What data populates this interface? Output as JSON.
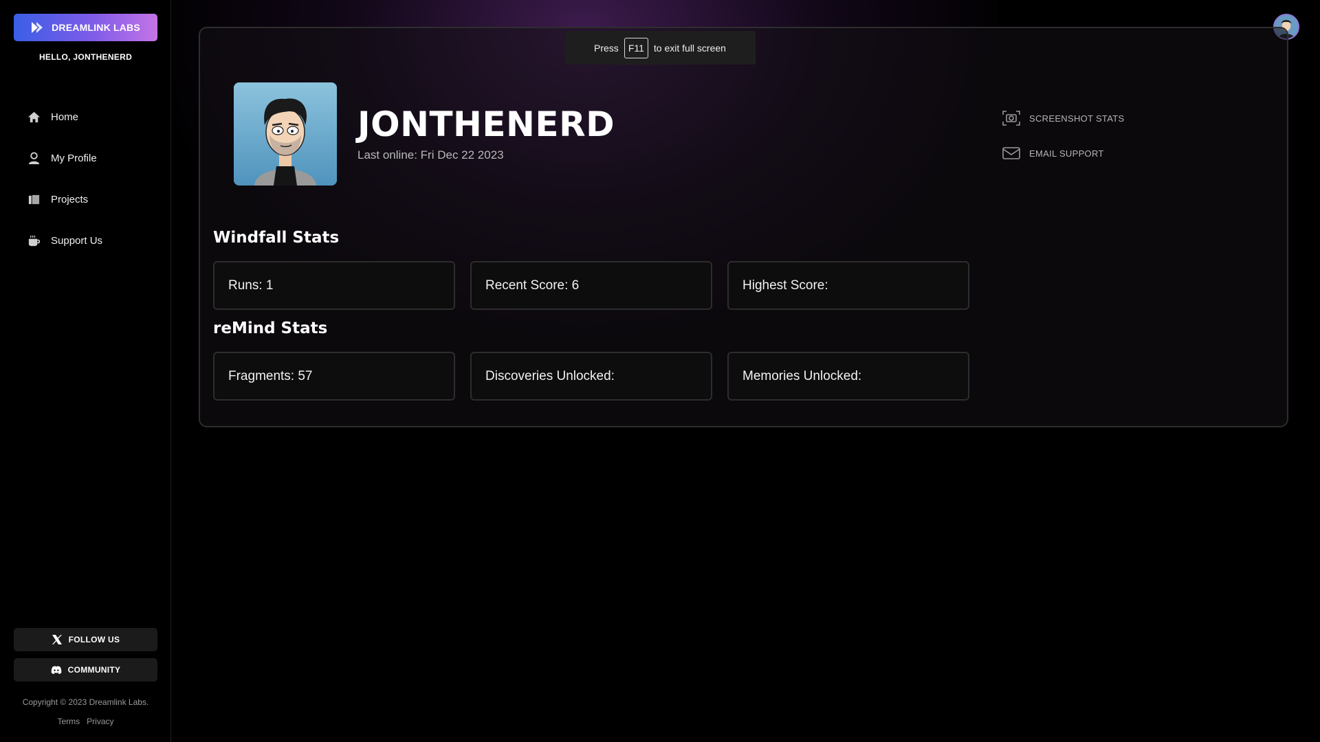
{
  "sidebar": {
    "brand_label": "DREAMLINK LABS",
    "greeting": "HELLO, JONTHENERD",
    "nav": [
      {
        "label": "Home",
        "icon": "home-icon"
      },
      {
        "label": "My Profile",
        "icon": "user-icon"
      },
      {
        "label": "Projects",
        "icon": "projects-icon"
      },
      {
        "label": "Support Us",
        "icon": "coffee-icon"
      }
    ],
    "follow_label": "FOLLOW US",
    "community_label": "COMMUNITY",
    "copyright": "Copyright © 2023 Dreamlink Labs.",
    "terms": "Terms",
    "privacy": "Privacy"
  },
  "fullscreen_notice": {
    "prefix": "Press",
    "key": "F11",
    "suffix": "to exit full screen"
  },
  "profile": {
    "username": "JONTHENERD",
    "last_online": "Last online: Fri Dec 22 2023"
  },
  "actions": {
    "screenshot": "SCREENSHOT STATS",
    "email": "EMAIL SUPPORT"
  },
  "windfall": {
    "title": "Windfall Stats",
    "runs": "Runs: 1",
    "recent": "Recent Score: 6",
    "highest": "Highest Score:"
  },
  "remind": {
    "title": "reMind Stats",
    "fragments": "Fragments: 57",
    "discoveries": "Discoveries Unlocked:",
    "memories": "Memories Unlocked:"
  },
  "colors": {
    "brand_gradient_start": "#3b5ee6",
    "brand_gradient_end": "#c474e6",
    "background": "#000000",
    "glow": "#6e328c"
  }
}
